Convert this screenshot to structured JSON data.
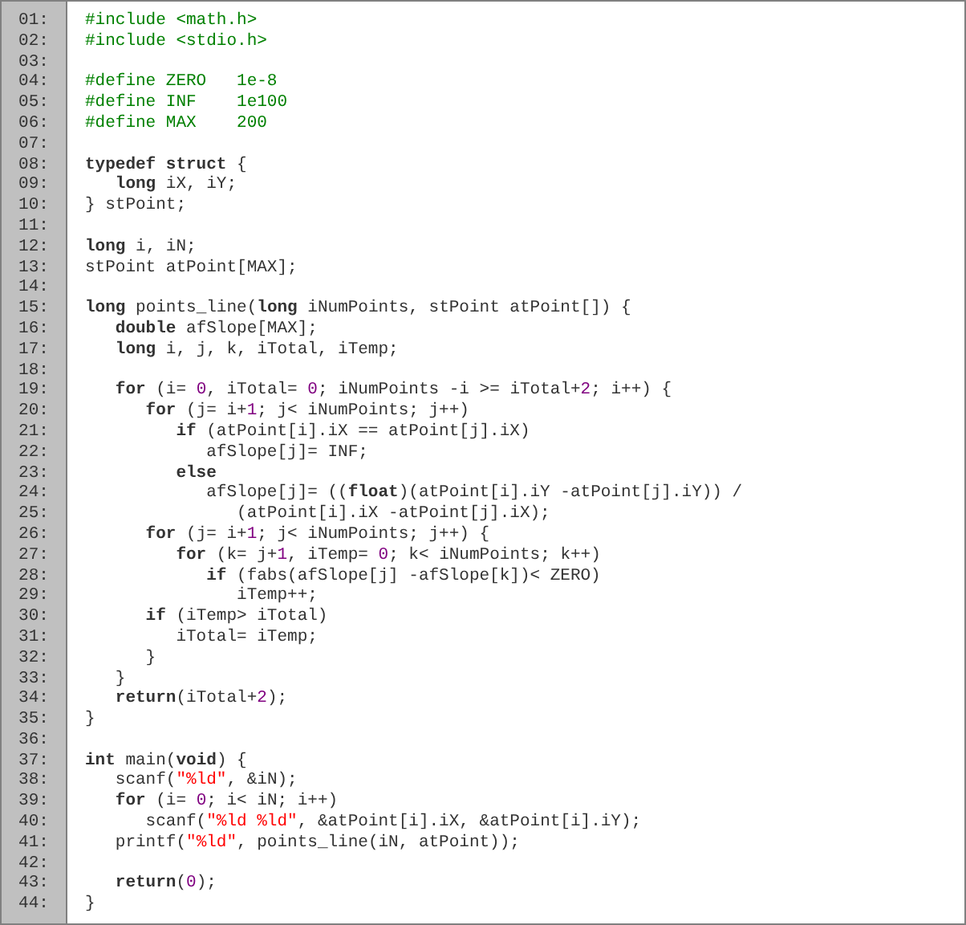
{
  "lines": [
    {
      "number": "01:",
      "tokens": [
        {
          "kind": "preproc",
          "text": "#include <math.h>"
        }
      ]
    },
    {
      "number": "02:",
      "tokens": [
        {
          "kind": "preproc",
          "text": "#include <stdio.h>"
        }
      ]
    },
    {
      "number": "03:"
    },
    {
      "number": "04:",
      "tokens": [
        {
          "kind": "preproc",
          "text": "#define ZERO   1e-8"
        }
      ]
    },
    {
      "number": "05:",
      "tokens": [
        {
          "kind": "preproc",
          "text": "#define INF    1e100"
        }
      ]
    },
    {
      "number": "06:",
      "tokens": [
        {
          "kind": "preproc",
          "text": "#define MAX    200"
        }
      ]
    },
    {
      "number": "07:"
    },
    {
      "number": "08:",
      "tokens": [
        {
          "kind": "keyword",
          "text": "typedef struct"
        },
        {
          "kind": "plain",
          "text": " {"
        }
      ]
    },
    {
      "number": "09:",
      "tokens": [
        {
          "kind": "keyword",
          "text": "   long"
        },
        {
          "kind": "plain",
          "text": " iX, iY;"
        }
      ]
    },
    {
      "number": "10:",
      "tokens": [
        {
          "kind": "plain",
          "text": "} stPoint;"
        }
      ]
    },
    {
      "number": "11:"
    },
    {
      "number": "12:",
      "tokens": [
        {
          "kind": "keyword",
          "text": "long"
        },
        {
          "kind": "plain",
          "text": " i, iN;"
        }
      ]
    },
    {
      "number": "13:",
      "tokens": [
        {
          "kind": "plain",
          "text": "stPoint atPoint[MAX];"
        }
      ]
    },
    {
      "number": "14:"
    },
    {
      "number": "15:",
      "tokens": [
        {
          "kind": "keyword",
          "text": "long"
        },
        {
          "kind": "plain",
          "text": " points_line("
        },
        {
          "kind": "keyword",
          "text": "long"
        },
        {
          "kind": "plain",
          "text": " iNumPoints, stPoint atPoint[]) {"
        }
      ]
    },
    {
      "number": "16:",
      "tokens": [
        {
          "kind": "keyword",
          "text": "   double"
        },
        {
          "kind": "plain",
          "text": " afSlope[MAX];"
        }
      ]
    },
    {
      "number": "17:",
      "tokens": [
        {
          "kind": "keyword",
          "text": "   long"
        },
        {
          "kind": "plain",
          "text": " i, j, k, iTotal, iTemp;"
        }
      ]
    },
    {
      "number": "18:"
    },
    {
      "number": "19:",
      "tokens": [
        {
          "kind": "keyword",
          "text": "   for"
        },
        {
          "kind": "plain",
          "text": " (i= "
        },
        {
          "kind": "number",
          "text": "0"
        },
        {
          "kind": "plain",
          "text": ", iTotal= "
        },
        {
          "kind": "number",
          "text": "0"
        },
        {
          "kind": "plain",
          "text": "; iNumPoints -i >= iTotal+"
        },
        {
          "kind": "number",
          "text": "2"
        },
        {
          "kind": "plain",
          "text": "; i++) {"
        }
      ]
    },
    {
      "number": "20:",
      "tokens": [
        {
          "kind": "keyword",
          "text": "      for"
        },
        {
          "kind": "plain",
          "text": " (j= i+"
        },
        {
          "kind": "number",
          "text": "1"
        },
        {
          "kind": "plain",
          "text": "; j< iNumPoints; j++)"
        }
      ]
    },
    {
      "number": "21:",
      "tokens": [
        {
          "kind": "keyword",
          "text": "         if"
        },
        {
          "kind": "plain",
          "text": " (atPoint[i].iX == atPoint[j].iX)"
        }
      ]
    },
    {
      "number": "22:",
      "tokens": [
        {
          "kind": "plain",
          "text": "            afSlope[j]= INF;"
        }
      ]
    },
    {
      "number": "23:",
      "tokens": [
        {
          "kind": "keyword",
          "text": "         else"
        }
      ]
    },
    {
      "number": "24:",
      "tokens": [
        {
          "kind": "plain",
          "text": "            afSlope[j]= (("
        },
        {
          "kind": "keyword",
          "text": "float"
        },
        {
          "kind": "plain",
          "text": ")(atPoint[i].iY -atPoint[j].iY)) /"
        }
      ]
    },
    {
      "number": "25:",
      "tokens": [
        {
          "kind": "plain",
          "text": "               (atPoint[i].iX -atPoint[j].iX);"
        }
      ]
    },
    {
      "number": "26:",
      "tokens": [
        {
          "kind": "keyword",
          "text": "      for"
        },
        {
          "kind": "plain",
          "text": " (j= i+"
        },
        {
          "kind": "number",
          "text": "1"
        },
        {
          "kind": "plain",
          "text": "; j< iNumPoints; j++) {"
        }
      ]
    },
    {
      "number": "27:",
      "tokens": [
        {
          "kind": "keyword",
          "text": "         for"
        },
        {
          "kind": "plain",
          "text": " (k= j+"
        },
        {
          "kind": "number",
          "text": "1"
        },
        {
          "kind": "plain",
          "text": ", iTemp= "
        },
        {
          "kind": "number",
          "text": "0"
        },
        {
          "kind": "plain",
          "text": "; k< iNumPoints; k++)"
        }
      ]
    },
    {
      "number": "28:",
      "tokens": [
        {
          "kind": "keyword",
          "text": "            if"
        },
        {
          "kind": "plain",
          "text": " (fabs(afSlope[j] -afSlope[k])< ZERO)"
        }
      ]
    },
    {
      "number": "29:",
      "tokens": [
        {
          "kind": "plain",
          "text": "               iTemp++;"
        }
      ]
    },
    {
      "number": "30:",
      "tokens": [
        {
          "kind": "keyword",
          "text": "      if"
        },
        {
          "kind": "plain",
          "text": " (iTemp> iTotal)"
        }
      ]
    },
    {
      "number": "31:",
      "tokens": [
        {
          "kind": "plain",
          "text": "         iTotal= iTemp;"
        }
      ]
    },
    {
      "number": "32:",
      "tokens": [
        {
          "kind": "plain",
          "text": "      }"
        }
      ]
    },
    {
      "number": "33:",
      "tokens": [
        {
          "kind": "plain",
          "text": "   }"
        }
      ]
    },
    {
      "number": "34:",
      "tokens": [
        {
          "kind": "keyword",
          "text": "   return"
        },
        {
          "kind": "plain",
          "text": "(iTotal+"
        },
        {
          "kind": "number",
          "text": "2"
        },
        {
          "kind": "plain",
          "text": ");"
        }
      ]
    },
    {
      "number": "35:",
      "tokens": [
        {
          "kind": "plain",
          "text": "}"
        }
      ]
    },
    {
      "number": "36:"
    },
    {
      "number": "37:",
      "tokens": [
        {
          "kind": "keyword",
          "text": "int"
        },
        {
          "kind": "plain",
          "text": " main("
        },
        {
          "kind": "keyword",
          "text": "void"
        },
        {
          "kind": "plain",
          "text": ") {"
        }
      ]
    },
    {
      "number": "38:",
      "tokens": [
        {
          "kind": "plain",
          "text": "   scanf("
        },
        {
          "kind": "string",
          "text": "\"%ld\""
        },
        {
          "kind": "plain",
          "text": ", &iN);"
        }
      ]
    },
    {
      "number": "39:",
      "tokens": [
        {
          "kind": "keyword",
          "text": "   for"
        },
        {
          "kind": "plain",
          "text": " (i= "
        },
        {
          "kind": "number",
          "text": "0"
        },
        {
          "kind": "plain",
          "text": "; i< iN; i++)"
        }
      ]
    },
    {
      "number": "40:",
      "tokens": [
        {
          "kind": "plain",
          "text": "      scanf("
        },
        {
          "kind": "string",
          "text": "\"%ld %ld\""
        },
        {
          "kind": "plain",
          "text": ", &atPoint[i].iX, &atPoint[i].iY);"
        }
      ]
    },
    {
      "number": "41:",
      "tokens": [
        {
          "kind": "plain",
          "text": "   printf("
        },
        {
          "kind": "string",
          "text": "\"%ld\""
        },
        {
          "kind": "plain",
          "text": ", points_line(iN, atPoint));"
        }
      ]
    },
    {
      "number": "42:"
    },
    {
      "number": "43:",
      "tokens": [
        {
          "kind": "keyword",
          "text": "   return"
        },
        {
          "kind": "plain",
          "text": "("
        },
        {
          "kind": "number",
          "text": "0"
        },
        {
          "kind": "plain",
          "text": ");"
        }
      ]
    },
    {
      "number": "44:",
      "tokens": [
        {
          "kind": "plain",
          "text": "}"
        }
      ]
    }
  ]
}
